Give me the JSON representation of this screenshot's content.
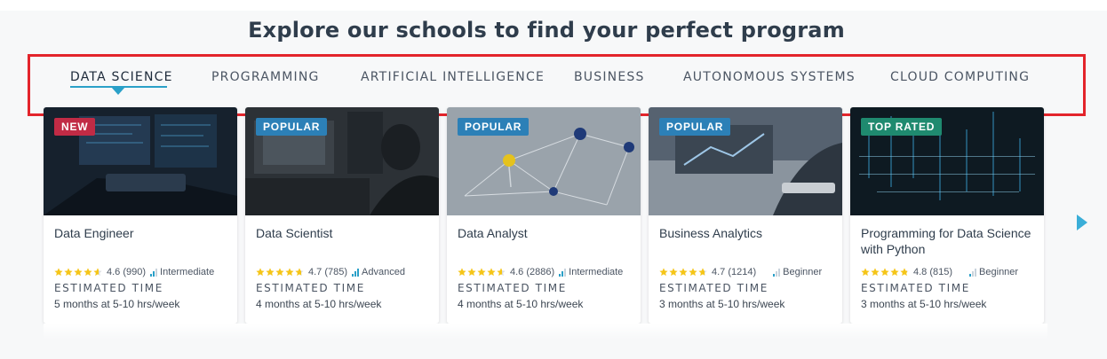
{
  "heading": "Explore our schools to find your perfect program",
  "tabs": [
    {
      "label": "DATA SCIENCE",
      "active": true
    },
    {
      "label": "PROGRAMMING",
      "active": false
    },
    {
      "label": "ARTIFICIAL INTELLIGENCE",
      "active": false
    },
    {
      "label": "BUSINESS",
      "active": false
    },
    {
      "label": "AUTONOMOUS SYSTEMS",
      "active": false
    },
    {
      "label": "CLOUD COMPUTING",
      "active": false
    }
  ],
  "estimated_label": "ESTIMATED TIME",
  "cards": [
    {
      "badge": "NEW",
      "title": "Data Engineer",
      "rating": "4.6",
      "reviews": "(990)",
      "stars": 4.6,
      "level": "Intermediate",
      "time": "5 months at 5-10 hrs/week"
    },
    {
      "badge": "POPULAR",
      "title": "Data Scientist",
      "rating": "4.7",
      "reviews": "(785)",
      "stars": 4.7,
      "level": "Advanced",
      "time": "4 months at 5-10 hrs/week"
    },
    {
      "badge": "POPULAR",
      "title": "Data Analyst",
      "rating": "4.6",
      "reviews": "(2886)",
      "stars": 4.6,
      "level": "Intermediate",
      "time": "4 months at 5-10 hrs/week"
    },
    {
      "badge": "POPULAR",
      "title": "Business Analytics",
      "rating": "4.7",
      "reviews": "(1214)",
      "stars": 4.7,
      "level": "Beginner",
      "time": "3 months at 5-10 hrs/week"
    },
    {
      "badge": "TOP RATED",
      "title": "Programming for Data Science with Python",
      "rating": "4.8",
      "reviews": "(815)",
      "stars": 4.8,
      "level": "Beginner",
      "time": "3 months at 5-10 hrs/week"
    }
  ],
  "colors": {
    "accent": "#2aa0c8",
    "highlight_box": "#e3242b",
    "badge_new": "#c12b45",
    "badge_popular": "#2c80b7",
    "badge_top_rated": "#1f8a6f",
    "star": "#f5c518"
  },
  "icons": {
    "star": "star-icon",
    "level": "level-bars-icon",
    "next": "chevron-right-icon"
  }
}
